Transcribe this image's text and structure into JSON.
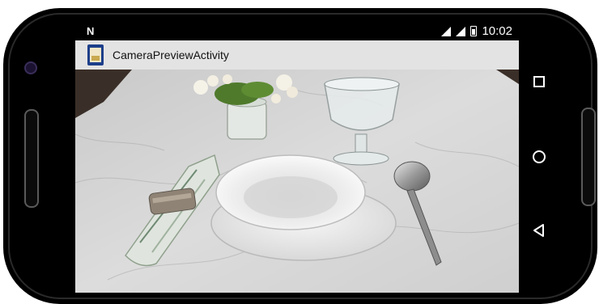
{
  "status_bar": {
    "notification_icon": "N",
    "time": "10:02",
    "icons": [
      "signal-icon",
      "signal-icon",
      "battery-icon"
    ]
  },
  "app_bar": {
    "title": "CameraPreviewActivity",
    "icon": "app-icon"
  },
  "camera_preview": {
    "scene": [
      "marble-table",
      "flower-vase",
      "wine-glass",
      "napkin-with-ring",
      "bowl",
      "plate",
      "spoon"
    ]
  },
  "nav_bar": {
    "buttons": [
      "recents-square-icon",
      "home-circle-icon",
      "back-triangle-icon"
    ]
  },
  "colors": {
    "frame": "#000000",
    "app_bar_bg": "#e3e3e3",
    "status_bar_bg": "#000000"
  }
}
